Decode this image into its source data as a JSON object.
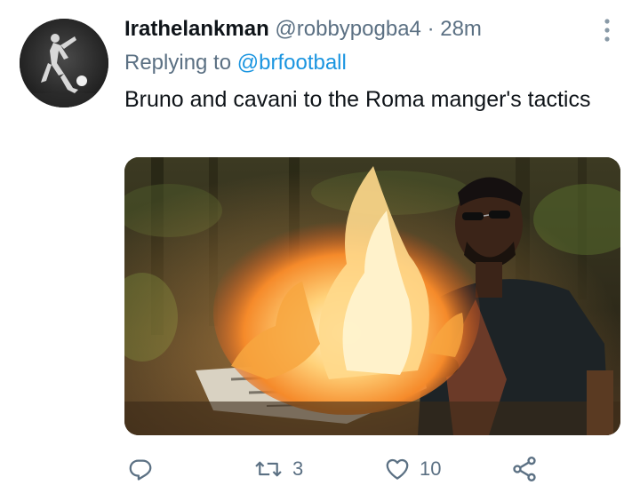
{
  "tweet": {
    "author_name": "Irathelankman",
    "handle": "@robbypogba4",
    "separator": "·",
    "time": "28m",
    "replying_prefix": "Replying to",
    "replying_to": "@brfootball",
    "text": "Bruno and cavani to the Roma manger's tactics",
    "avatar_icon": "avatar-footballer-silhouette",
    "media_description_icon": "burning-newspaper-photo"
  },
  "actions": {
    "reply_icon": "reply-icon",
    "retweet_icon": "retweet-icon",
    "retweet_count": "3",
    "like_icon": "heart-icon",
    "like_count": "10",
    "share_icon": "share-icon"
  },
  "colors": {
    "text": "#0f1419",
    "secondary": "#5b7083",
    "link": "#1b95e0",
    "background": "#ffffff"
  }
}
